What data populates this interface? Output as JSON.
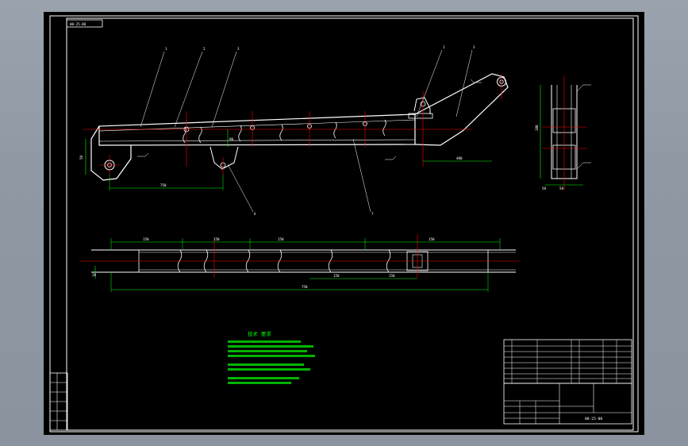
{
  "sheet": {
    "drawing_code": "00-25-00",
    "colors": {
      "background": "#000000",
      "outline": "#ffffff",
      "centerline": "#ff0000",
      "dimension": "#00ff00",
      "note": "#00ff00"
    }
  },
  "front_view": {
    "balloons": [
      "1",
      "2",
      "3",
      "1",
      "3",
      "6",
      "7"
    ],
    "dimensions": {
      "height_left": "50",
      "length_left": "750",
      "length_right": "400",
      "pin_dim": "90"
    }
  },
  "plan_view": {
    "dimensions": {
      "top": [
        "150",
        "150",
        "150",
        "150"
      ],
      "mid": [
        "150",
        "150"
      ],
      "overall": "750",
      "width": "20"
    }
  },
  "side_view": {
    "dimensions": {
      "height": "100",
      "base_left": "50",
      "base_right": "50"
    }
  },
  "notes": {
    "title": "技术 要求",
    "lines": [
      "",
      "",
      "",
      "",
      "",
      "",
      "",
      ""
    ]
  },
  "title_block": {
    "name": "",
    "material": "",
    "scale": "",
    "code": "00-25-00",
    "row_labels": [
      "",
      "",
      "",
      "",
      "",
      "",
      ""
    ]
  },
  "left_strip": {
    "labels": [
      "",
      "",
      "",
      "",
      "",
      ""
    ]
  }
}
